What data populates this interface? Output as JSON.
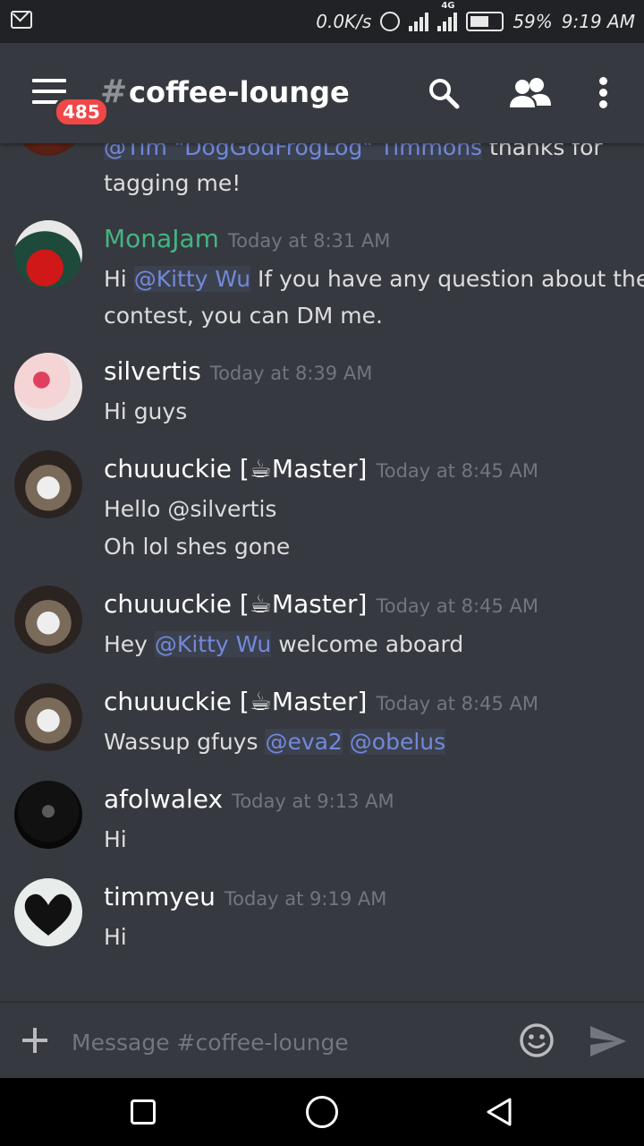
{
  "status_bar": {
    "net_speed": "0.0K/s",
    "network": "4G",
    "battery": "59%",
    "time": "9:19 AM"
  },
  "header": {
    "unread_badge": "485",
    "hash_symbol": "#",
    "channel_name": "coffee-lounge"
  },
  "messages": {
    "partial_top": {
      "line1_mention": "@Tim \"DogGodFrogLog\" Timmons",
      "line1_text": " thanks for",
      "line2_text": "tagging me!"
    },
    "m1": {
      "user": "MonaJam",
      "user_color": "#43b581",
      "time": "Today at 8:31 AM",
      "l1_pre": "Hi ",
      "l1_mention": "@Kitty Wu",
      "l1_post": "  If you have any question about the",
      "l2": "contest, you can DM me."
    },
    "m2": {
      "user": "silvertis",
      "time": "Today at 8:39 AM",
      "l1": "Hi guys"
    },
    "m3": {
      "user": "chuuuckie [☕Master]",
      "time": "Today at 8:45 AM",
      "l1": "Hello @silvertis",
      "l2": "Oh lol shes gone"
    },
    "m4": {
      "user": "chuuuckie [☕Master]",
      "time": "Today at 8:45 AM",
      "l1_pre": "Hey ",
      "l1_mention": "@Kitty Wu",
      "l1_post": "  welcome aboard"
    },
    "m5": {
      "user": "chuuuckie [☕Master]",
      "time": "Today at 8:45 AM",
      "l1_pre": "Wassup  gfuys ",
      "l1_mention1": "@eva2",
      "l1_mention2": "@obelus"
    },
    "m6": {
      "user": "afolwalex",
      "time": "Today at 9:13 AM",
      "l1": "Hi"
    },
    "m7": {
      "user": "timmyeu",
      "time": "Today at 9:19 AM",
      "l1": "Hi"
    }
  },
  "composer": {
    "placeholder": "Message #coffee-lounge"
  },
  "colors": {
    "background": "#36393f",
    "mention": "#7289da",
    "badge": "#f04747"
  }
}
